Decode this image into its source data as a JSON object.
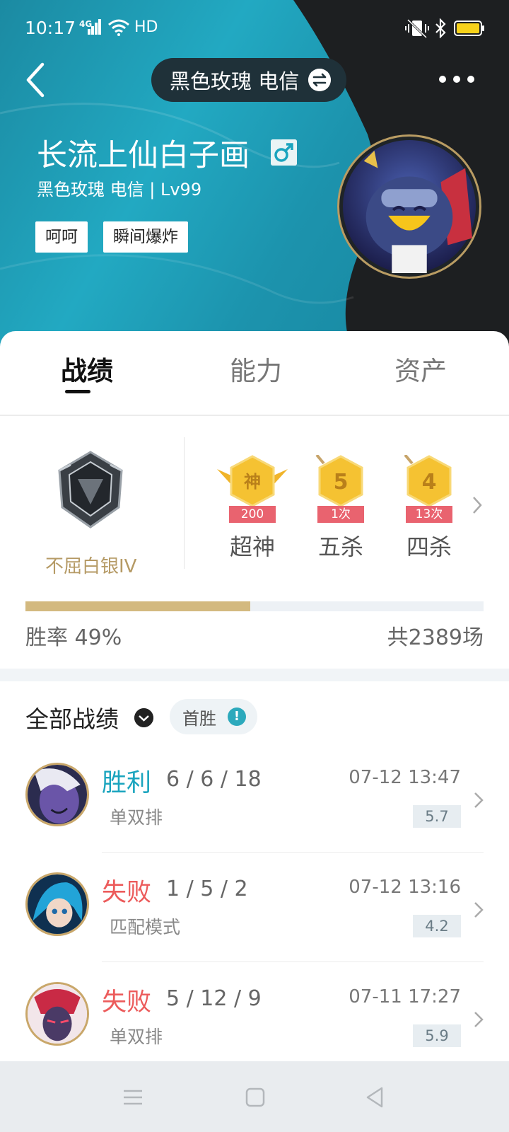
{
  "status_bar": {
    "time": "10:17",
    "network": "4G",
    "hd": "HD"
  },
  "header": {
    "server": "黑色玫瑰 电信",
    "player_name": "长流上仙白子画",
    "player_sub": "黑色玫瑰 电信 | Lv99",
    "tags": [
      "呵呵",
      "瞬间爆炸"
    ],
    "gender_icon": "male-icon"
  },
  "tabs": [
    {
      "label": "战绩",
      "active": true
    },
    {
      "label": "能力",
      "active": false
    },
    {
      "label": "资产",
      "active": false
    }
  ],
  "rank": {
    "name": "不屈白银IV"
  },
  "honors": [
    {
      "badge": "神",
      "count": "200次",
      "label": "超神"
    },
    {
      "badge": "5",
      "count": "1次",
      "label": "五杀"
    },
    {
      "badge": "4",
      "count": "13次",
      "label": "四杀"
    }
  ],
  "stats": {
    "win_rate_label": "胜率  49%",
    "win_rate_value": 0.49,
    "total_games": "共2389场"
  },
  "match_list": {
    "title": "全部战绩",
    "filter_chip": "首胜",
    "info_mark": "!",
    "matches": [
      {
        "result": "胜利",
        "kda": "6 / 6 / 18",
        "time": "07-12 13:47",
        "mode": "单双排",
        "score": "5.7",
        "outcome": "win"
      },
      {
        "result": "失败",
        "kda": "1 / 5 / 2",
        "time": "07-12 13:16",
        "mode": "匹配模式",
        "score": "4.2",
        "outcome": "loss"
      },
      {
        "result": "失败",
        "kda": "5 / 12 / 9",
        "time": "07-11 17:27",
        "mode": "单双排",
        "score": "5.9",
        "outcome": "loss"
      }
    ]
  },
  "colors": {
    "accent_teal": "#1aa4be",
    "win": "#1aa4be",
    "loss": "#ec5b5b",
    "rank_gold": "#b59a65",
    "honor_gold": "#f5c232",
    "honor_ribbon": "#e9636f"
  }
}
